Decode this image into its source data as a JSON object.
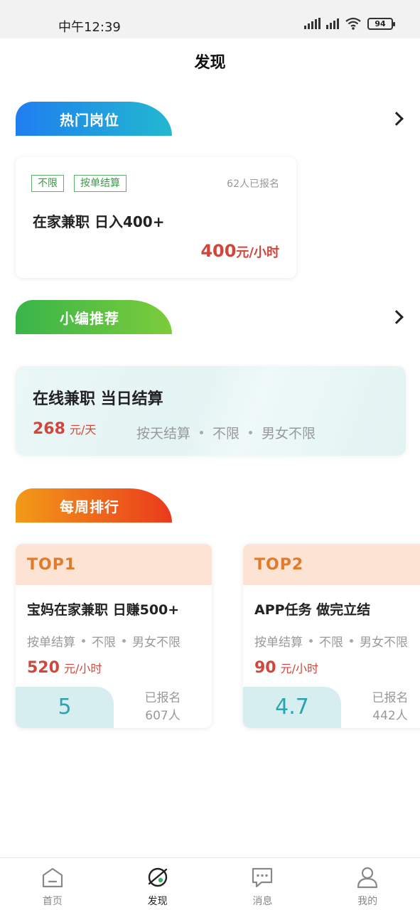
{
  "status": {
    "time": "中午12:39",
    "battery": "94"
  },
  "header": {
    "title": "发现"
  },
  "sections": {
    "hot": {
      "title": "热门岗位"
    },
    "recommend": {
      "title": "小编推荐"
    },
    "weekly": {
      "title": "每周排行"
    }
  },
  "hot_job": {
    "tags": [
      "不限",
      "按单结算"
    ],
    "signup_count": "62人已报名",
    "title": "在家兼职 日入400+",
    "price": "400",
    "price_unit": "元/小时"
  },
  "recommend_job": {
    "title": "在线兼职 当日结算",
    "price": "268",
    "price_unit": "元/天",
    "meta": [
      "按天结算",
      "不限",
      "男女不限"
    ]
  },
  "ranking": [
    {
      "rank": "TOP1",
      "title": "宝妈在家兼职 日赚500+",
      "meta": [
        "按单结算",
        "不限",
        "男女不限"
      ],
      "price": "520",
      "price_unit": "元/小时",
      "score": "5",
      "signed_label": "已报名",
      "signed_count": "607人"
    },
    {
      "rank": "TOP2",
      "title": "APP任务 做完立结",
      "meta": [
        "按单结算",
        "不限",
        "男女不限"
      ],
      "price": "90",
      "price_unit": "元/小时",
      "score": "4.7",
      "signed_label": "已报名",
      "signed_count": "442人"
    }
  ],
  "nav": {
    "items": [
      {
        "label": "首页",
        "icon": "home-icon"
      },
      {
        "label": "发现",
        "icon": "discover-icon"
      },
      {
        "label": "消息",
        "icon": "message-icon"
      },
      {
        "label": "我的",
        "icon": "profile-icon"
      }
    ],
    "active": "发现"
  },
  "colors": {
    "price": "#d0463c",
    "tag": "#3a9a4a",
    "rank_header": "#fde3d3",
    "score_bg": "#d7eef0"
  }
}
